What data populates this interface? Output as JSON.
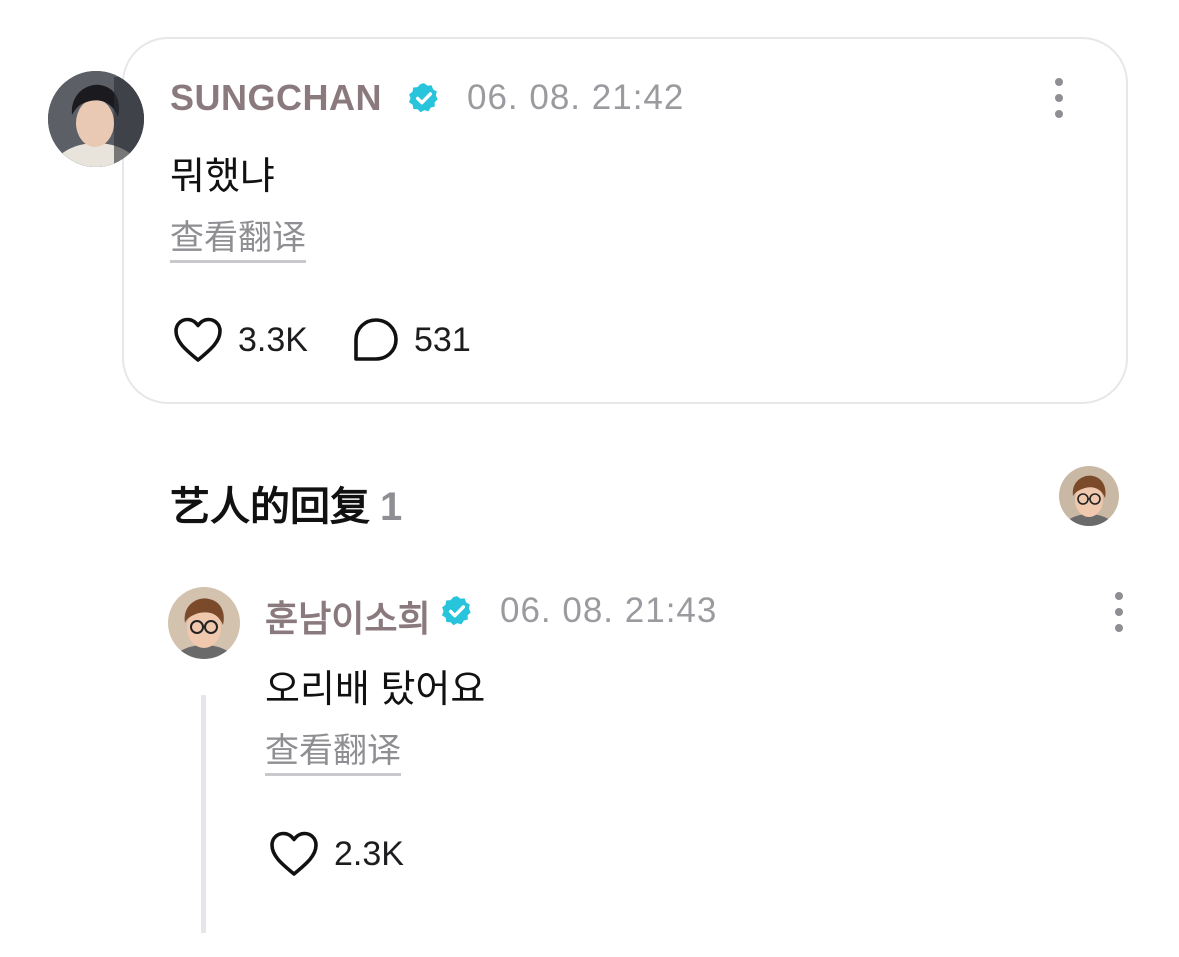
{
  "post": {
    "username": "SUNGCHAN",
    "timestamp": "06. 08. 21:42",
    "text": "뭐했냐",
    "translate_label": "查看翻译",
    "likes": "3.3K",
    "comments": "531"
  },
  "artist_replies": {
    "title": "艺人的回复",
    "count": "1"
  },
  "reply": {
    "username": "훈남이소희",
    "timestamp": "06. 08. 21:43",
    "text": "오리배 탔어요",
    "translate_label": "查看翻译",
    "likes": "2.3K"
  },
  "colors": {
    "verified": "#27c4dc",
    "username": "#8a7a7d",
    "muted": "#8e8e93"
  }
}
